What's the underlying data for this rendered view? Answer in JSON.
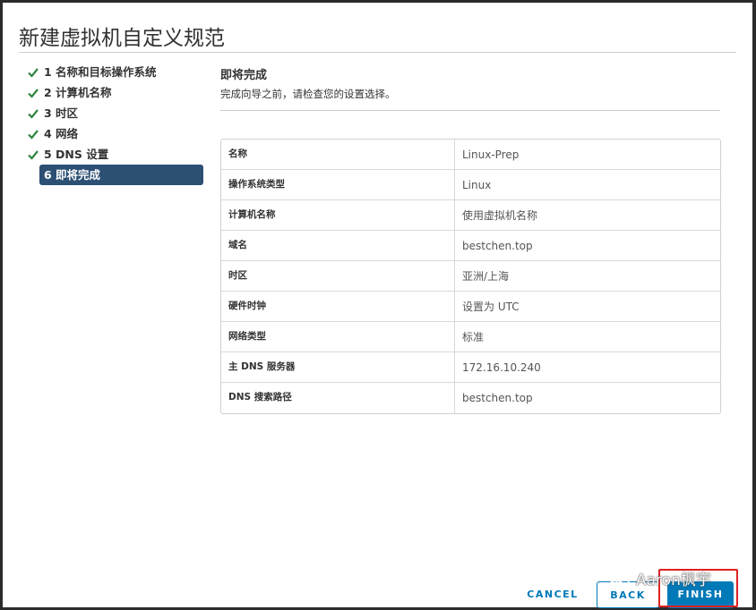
{
  "dialog": {
    "title": "新建虚拟机自定义规范"
  },
  "steps": [
    {
      "label": "1 名称和目标操作系统",
      "done": true,
      "active": false
    },
    {
      "label": "2 计算机名称",
      "done": true,
      "active": false
    },
    {
      "label": "3 时区",
      "done": true,
      "active": false
    },
    {
      "label": "4 网络",
      "done": true,
      "active": false
    },
    {
      "label": "5 DNS 设置",
      "done": true,
      "active": false
    },
    {
      "label": "6 即将完成",
      "done": false,
      "active": true
    }
  ],
  "content": {
    "title": "即将完成",
    "description": "完成向导之前，请检查您的设置选择。"
  },
  "summary": [
    {
      "label": "名称",
      "value": "Linux-Prep"
    },
    {
      "label": "操作系统类型",
      "value": "Linux"
    },
    {
      "label": "计算机名称",
      "value": "使用虚拟机名称"
    },
    {
      "label": "域名",
      "value": "bestchen.top"
    },
    {
      "label": "时区",
      "value": "亚洲/上海"
    },
    {
      "label": "硬件时钟",
      "value": "设置为 UTC"
    },
    {
      "label": "网络类型",
      "value": "标准"
    },
    {
      "label": "主 DNS 服务器",
      "value": "172.16.10.240"
    },
    {
      "label": "DNS 搜索路径",
      "value": "bestchen.top"
    }
  ],
  "buttons": {
    "cancel": "CANCEL",
    "back": "BACK",
    "finish": "FINISH"
  },
  "watermark": "Aaron枫宇",
  "colors": {
    "accent": "#0079b8",
    "active_step": "#2c4f74",
    "check": "#2e8540",
    "highlight": "#e02020"
  }
}
